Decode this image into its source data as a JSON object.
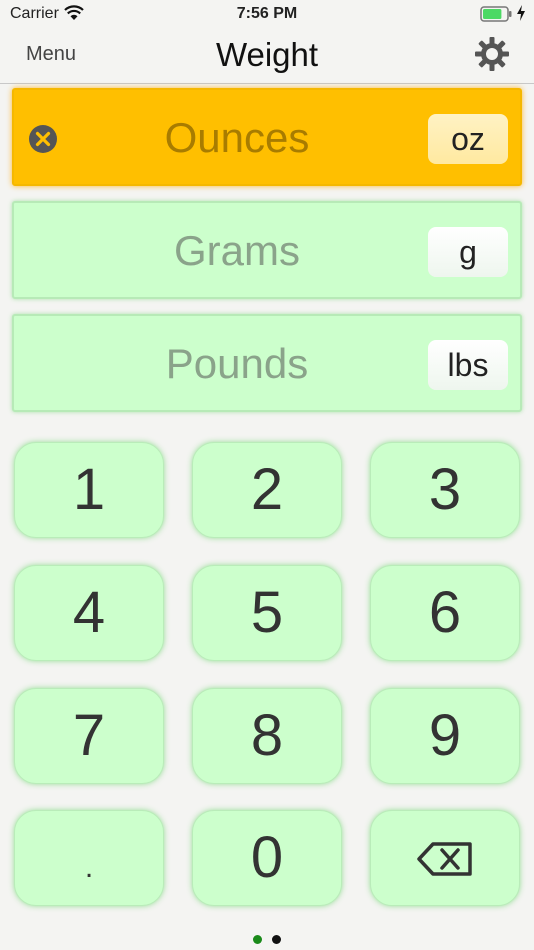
{
  "status_bar": {
    "carrier": "Carrier",
    "time": "7:56 PM",
    "battery_level": 0.8
  },
  "nav": {
    "menu_label": "Menu",
    "title": "Weight",
    "settings_icon": "gear-icon"
  },
  "units": [
    {
      "name": "Ounces",
      "abbr": "oz",
      "active": true
    },
    {
      "name": "Grams",
      "abbr": "g",
      "active": false
    },
    {
      "name": "Pounds",
      "abbr": "lbs",
      "active": false
    }
  ],
  "keypad": {
    "keys": [
      "1",
      "2",
      "3",
      "4",
      "5",
      "6",
      "7",
      "8",
      "9",
      ".",
      "0"
    ],
    "backspace_icon": "backspace-icon"
  },
  "pager": {
    "count": 2,
    "current": 1
  },
  "colors": {
    "active_row": "#ffbf00",
    "inactive_row": "#ccffcc",
    "key_bg": "#ccffcc",
    "pager_active": "#1a8a1a",
    "pager_inactive": "#111111"
  }
}
